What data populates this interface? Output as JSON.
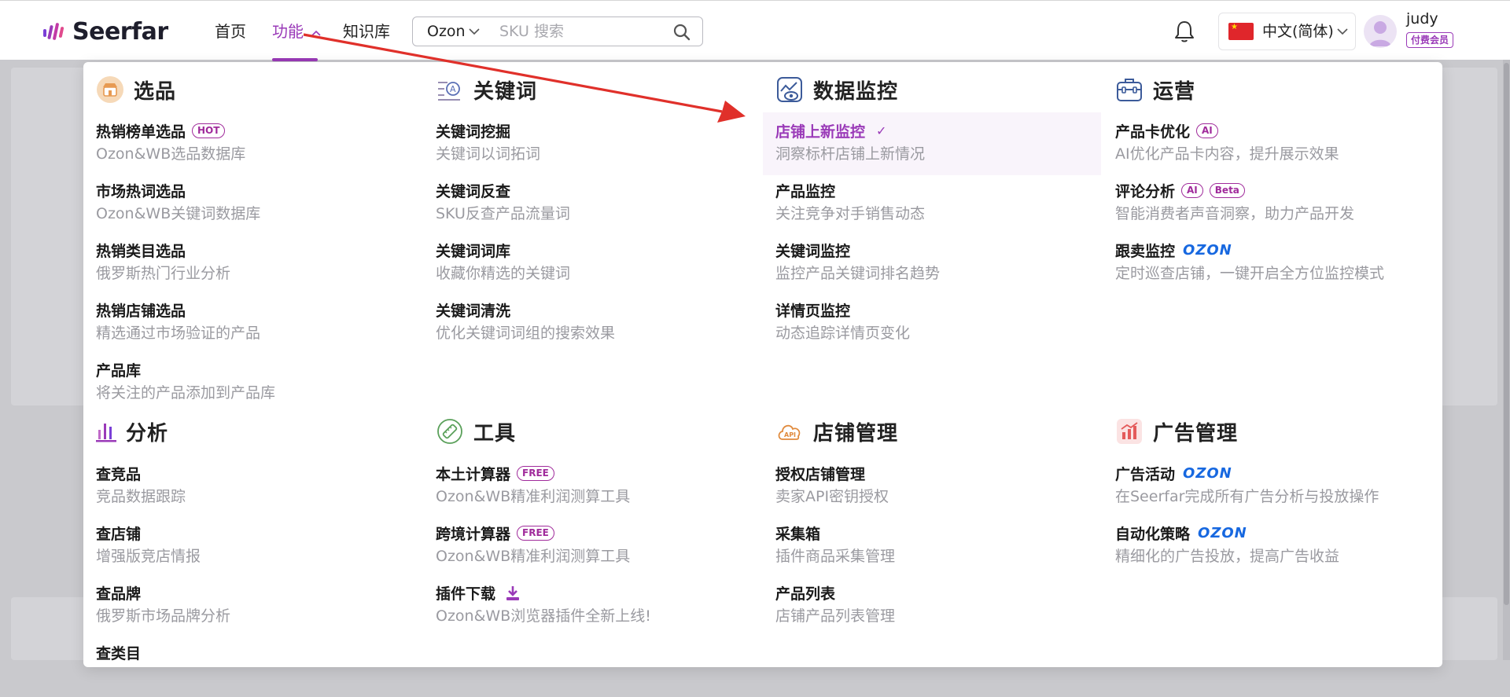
{
  "header": {
    "logo_text": "Seerfar",
    "nav": [
      "首页",
      "功能",
      "知识库"
    ],
    "active_nav": "功能",
    "search": {
      "marketplace": "Ozon",
      "placeholder": "SKU 搜索"
    },
    "language": "中文(简体)",
    "user": {
      "name": "judy",
      "badge": "付费会员"
    }
  },
  "colors": {
    "brand": "#9a3ab8",
    "ozon": "#1768e0",
    "tag": "#a02b9b",
    "annotation_arrow": "#e0302a"
  },
  "menu": {
    "selection": {
      "title": "选品",
      "items": [
        {
          "title": "热销榜单选品",
          "tag": "HOT",
          "desc": "Ozon&WB选品数据库"
        },
        {
          "title": "市场热词选品",
          "desc": "Ozon&WB关键词数据库"
        },
        {
          "title": "热销类目选品",
          "desc": "俄罗斯热门行业分析"
        },
        {
          "title": "热销店铺选品",
          "desc": "精选通过市场验证的产品"
        },
        {
          "title": "产品库",
          "desc": "将关注的产品添加到产品库"
        }
      ]
    },
    "keywords": {
      "title": "关键词",
      "items": [
        {
          "title": "关键词挖掘",
          "desc": "关键词以词拓词"
        },
        {
          "title": "关键词反查",
          "desc": "SKU反查产品流量词"
        },
        {
          "title": "关键词词库",
          "desc": "收藏你精选的关键词"
        },
        {
          "title": "关键词清洗",
          "desc": "优化关键词词组的搜索效果"
        }
      ]
    },
    "monitoring": {
      "title": "数据监控",
      "items": [
        {
          "title": "店铺上新监控",
          "desc": "洞察标杆店铺上新情况",
          "active": true,
          "check": "✓"
        },
        {
          "title": "产品监控",
          "desc": "关注竞争对手销售动态"
        },
        {
          "title": "关键词监控",
          "desc": "监控产品关键词排名趋势"
        },
        {
          "title": "详情页监控",
          "desc": "动态追踪详情页变化"
        }
      ]
    },
    "operations": {
      "title": "运营",
      "items": [
        {
          "title": "产品卡优化",
          "tag": "AI",
          "desc": "AI优化产品卡内容，提升展示效果"
        },
        {
          "title": "评论分析",
          "tag": "AI",
          "tag2": "Beta",
          "desc": "智能消费者声音洞察，助力产品开发"
        },
        {
          "title": "跟卖监控",
          "brand": "OZON",
          "desc": "定时巡查店铺，一键开启全方位监控模式"
        }
      ]
    },
    "analysis": {
      "title": "分析",
      "items": [
        {
          "title": "查竞品",
          "desc": "竞品数据跟踪"
        },
        {
          "title": "查店铺",
          "desc": "增强版竞店情报"
        },
        {
          "title": "查品牌",
          "desc": "俄罗斯市场品牌分析"
        },
        {
          "title": "查类目",
          "desc": ""
        }
      ]
    },
    "tools": {
      "title": "工具",
      "items": [
        {
          "title": "本土计算器",
          "tag": "FREE",
          "desc": "Ozon&WB精准利润测算工具"
        },
        {
          "title": "跨境计算器",
          "tag": "FREE",
          "desc": "Ozon&WB精准利润测算工具"
        },
        {
          "title": "插件下载",
          "desc": "Ozon&WB浏览器插件全新上线!"
        }
      ]
    },
    "store": {
      "title": "店铺管理",
      "items": [
        {
          "title": "授权店铺管理",
          "desc": "卖家API密钥授权"
        },
        {
          "title": "采集箱",
          "desc": "插件商品采集管理"
        },
        {
          "title": "产品列表",
          "desc": "店铺产品列表管理"
        }
      ]
    },
    "ads": {
      "title": "广告管理",
      "items": [
        {
          "title": "广告活动",
          "brand": "OZON",
          "desc": "在Seerfar完成所有广告分析与投放操作"
        },
        {
          "title": "自动化策略",
          "brand": "OZON",
          "desc": "精细化的广告投放，提高广告收益"
        }
      ]
    }
  }
}
